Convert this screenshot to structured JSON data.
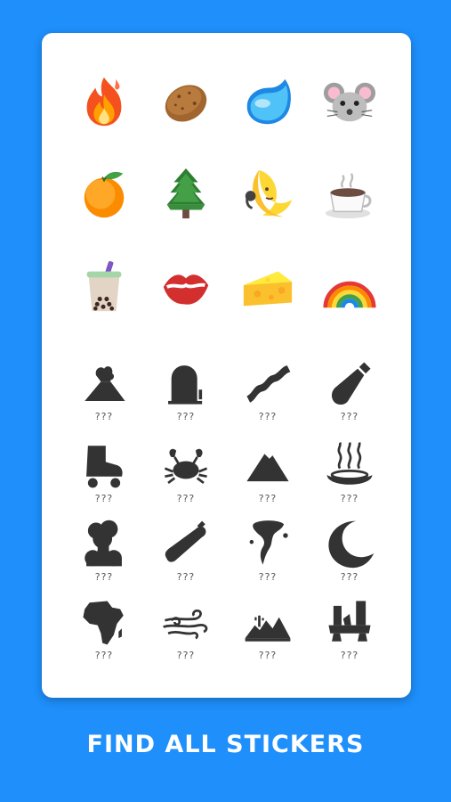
{
  "colors": {
    "background": "#1E8FFB",
    "card": "#FFFFFF",
    "silhouette": "#333333"
  },
  "unlocked_stickers": [
    {
      "name": "fire"
    },
    {
      "name": "potato"
    },
    {
      "name": "water-drop"
    },
    {
      "name": "mouse-face"
    },
    {
      "name": "tangerine"
    },
    {
      "name": "evergreen-tree"
    },
    {
      "name": "crescent-moon-face"
    },
    {
      "name": "hot-beverage"
    },
    {
      "name": "bubble-tea"
    },
    {
      "name": "kiss-mark"
    },
    {
      "name": "cheese-wedge"
    },
    {
      "name": "rainbow"
    }
  ],
  "locked_stickers": [
    {
      "name": "volcano",
      "label": "???"
    },
    {
      "name": "tombstone",
      "label": "???"
    },
    {
      "name": "bacon",
      "label": "???"
    },
    {
      "name": "baby-bottle",
      "label": "???"
    },
    {
      "name": "roller-skate",
      "label": "???"
    },
    {
      "name": "crab",
      "label": "???"
    },
    {
      "name": "mountain",
      "label": "???"
    },
    {
      "name": "hot-springs",
      "label": "???"
    },
    {
      "name": "mushroom-cloud",
      "label": "???"
    },
    {
      "name": "baguette",
      "label": "???"
    },
    {
      "name": "tornado",
      "label": "???"
    },
    {
      "name": "crescent-moon",
      "label": "???"
    },
    {
      "name": "africa",
      "label": "???"
    },
    {
      "name": "wind",
      "label": "???"
    },
    {
      "name": "desert",
      "label": "???"
    },
    {
      "name": "ruins",
      "label": "???"
    }
  ],
  "footer": {
    "text": "FIND ALL STICKERS"
  }
}
